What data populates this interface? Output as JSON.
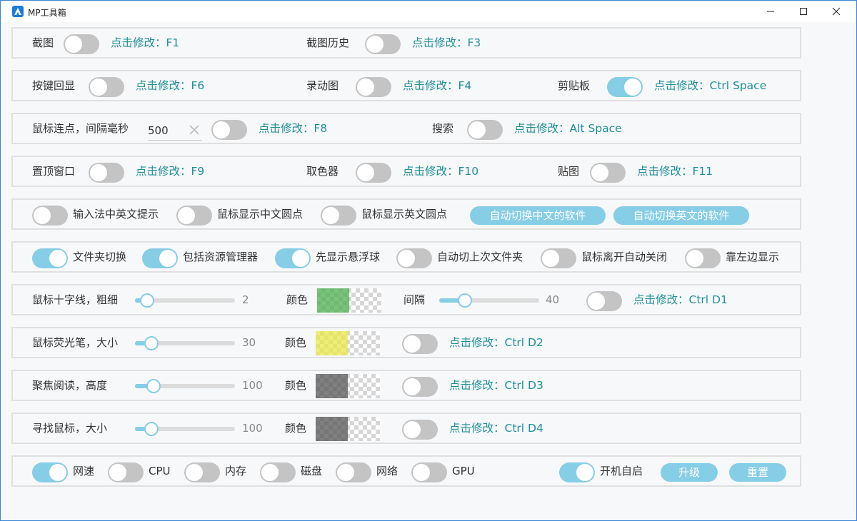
{
  "window": {
    "title": "MP工具箱",
    "accent": "#86cde6",
    "hint_color": "#1f8f98"
  },
  "rows": {
    "r1": {
      "screenshot_label": "截图",
      "screenshot_on": false,
      "screenshot_hint": "点击修改：F1",
      "history_label": "截图历史",
      "history_on": false,
      "history_hint": "点击修改：F3"
    },
    "r2": {
      "keyecho_label": "按键回显",
      "keyecho_on": false,
      "keyecho_hint": "点击修改：F6",
      "gif_label": "录动图",
      "gif_on": false,
      "gif_hint": "点击修改：F4",
      "clip_label": "剪贴板",
      "clip_on": true,
      "clip_hint": "点击修改：Ctrl Space"
    },
    "r3": {
      "autoclick_label": "鼠标连点，间隔毫秒",
      "interval_value": "500",
      "autoclick_on": false,
      "autoclick_hint": "点击修改：F8",
      "search_label": "搜索",
      "search_on": false,
      "search_hint": "点击修改：Alt Space"
    },
    "r4": {
      "pin_label": "置顶窗口",
      "pin_on": false,
      "pin_hint": "点击修改：F9",
      "picker_label": "取色器",
      "picker_on": false,
      "picker_hint": "点击修改：F10",
      "sticker_label": "贴图",
      "sticker_on": false,
      "sticker_hint": "点击修改：F11"
    },
    "r5": {
      "ime_label": "输入法中英文提示",
      "ime_on": false,
      "cn_dot_label": "鼠标显示中文圆点",
      "cn_dot_on": false,
      "en_dot_label": "鼠标显示英文圆点",
      "en_dot_on": false,
      "auto_cn_button": "自动切换中文的软件",
      "auto_en_button": "自动切换英文的软件"
    },
    "r6": {
      "folder_label": "文件夹切换",
      "folder_on": true,
      "explorer_label": "包括资源管理器",
      "explorer_on": true,
      "float_label": "先显示悬浮球",
      "float_on": true,
      "last_label": "自动切上次文件夹",
      "last_on": false,
      "leave_label": "鼠标离开自动关闭",
      "leave_on": false,
      "left_label": "靠左边显示",
      "left_on": false
    },
    "r7": {
      "crosshair_label": "鼠标十字线，粗细",
      "thickness": 2,
      "thickness_max": 40,
      "color_label": "颜色",
      "swatch_color": "#4caf50",
      "gap_label": "间隔",
      "gap": 40,
      "gap_max": 200,
      "crosshair_on": false,
      "crosshair_hint": "点击修改：Ctrl D1"
    },
    "r8": {
      "highlighter_label": "鼠标荧光笔，大小",
      "size": 30,
      "size_max": 300,
      "color_label": "颜色",
      "swatch_color": "#e8e84a",
      "highlighter_on": false,
      "highlighter_hint": "点击修改：Ctrl D2"
    },
    "r9": {
      "focus_label": "聚焦阅读，高度",
      "height": 100,
      "height_max": 800,
      "color_label": "颜色",
      "swatch_color": "#555555",
      "focus_on": false,
      "focus_hint": "点击修改：Ctrl D3"
    },
    "r10": {
      "find_label": "寻找鼠标，大小",
      "size": 100,
      "size_max": 1000,
      "color_label": "颜色",
      "swatch_color": "#555555",
      "find_on": false,
      "find_hint": "点击修改：Ctrl D4"
    },
    "r11": {
      "netspeed_label": "网速",
      "netspeed_on": true,
      "cpu_label": "CPU",
      "cpu_on": false,
      "mem_label": "内存",
      "mem_on": false,
      "disk_label": "磁盘",
      "disk_on": false,
      "net_label": "网络",
      "net_on": false,
      "gpu_label": "GPU",
      "gpu_on": false,
      "autostart_label": "开机自启",
      "autostart_on": true,
      "upgrade_button": "升级",
      "reset_button": "重置"
    }
  }
}
